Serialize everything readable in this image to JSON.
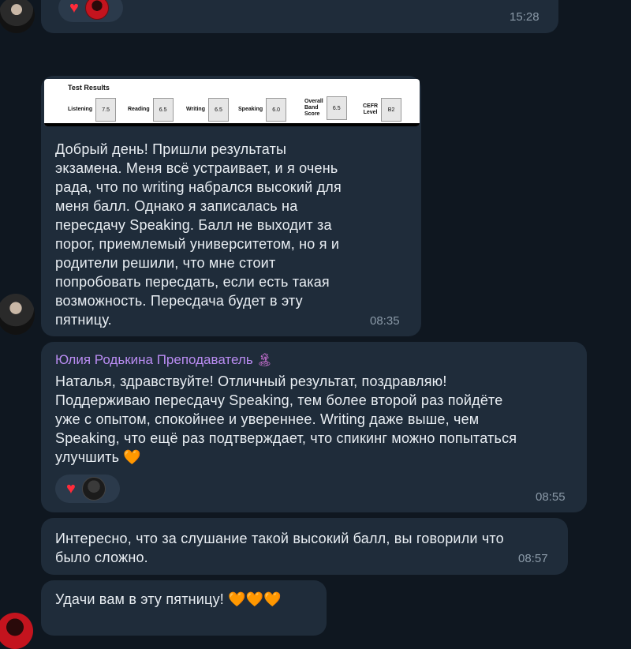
{
  "messages": {
    "m1": {
      "time": "15:28"
    },
    "m2": {
      "image": {
        "title": "Test Results",
        "scores": [
          {
            "label": "Listening",
            "value": "7.5"
          },
          {
            "label": "Reading",
            "value": "6.5"
          },
          {
            "label": "Writing",
            "value": "6.5"
          },
          {
            "label": "Speaking",
            "value": "6.0"
          },
          {
            "label": "Overall\nBand\nScore",
            "value": "6.5"
          },
          {
            "label": "CEFR\nLevel",
            "value": "B2"
          }
        ]
      },
      "text": "Добрый день! Пришли результаты\nэкзамена. Меня всё устраивает, и я очень\nрада, что по writing набрался высокий для\nменя балл. Однако я записалась на\nпересдачу Speaking. Балл не выходит за\nпорог, приемлемый университетом, но я и\nродители решили, что мне стоит\nпопробовать пересдать, если есть такая\nвозможность. Пересдача будет в эту\nпятницу.",
      "time": "08:35"
    },
    "m3": {
      "sender": "Юлия Родькина Преподаватель",
      "sender_emoji": "🏝",
      "text": "Наталья, здравствуйте! Отличный результат, поздравляю!\nПоддерживаю пересдачу Speaking, тем более второй раз пойдёте\nуже с опытом, спокойнее и увереннее. Writing даже выше, чем\nSpeaking, что ещё раз подтверждает, что спикинг можно попытаться\nулучшить",
      "emoji": "🧡",
      "time": "08:55"
    },
    "m4": {
      "text": "Интересно, что за слушание такой высокий балл, вы говорили что\nбыло сложно.",
      "time": "08:57"
    },
    "m5": {
      "text": "Удачи вам в эту пятницу!",
      "emoji": "🧡🧡🧡"
    }
  },
  "reactions": {
    "heart": "♥"
  },
  "colors": {
    "background": "#0f1720",
    "bubble": "#1f2c3a",
    "sender": "#b98cf2",
    "time": "#8b9aa8"
  }
}
